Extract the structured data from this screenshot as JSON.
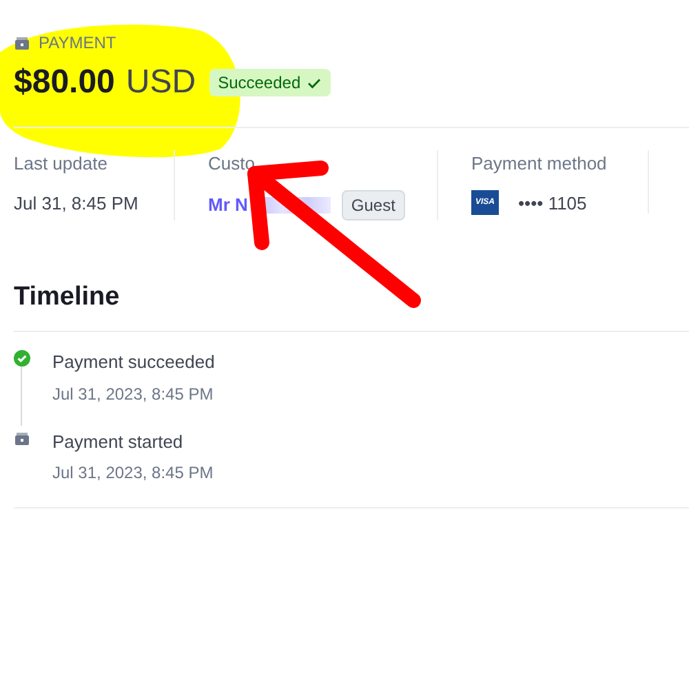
{
  "header": {
    "label": "PAYMENT",
    "amount": "$80.00",
    "currency": "USD",
    "status": {
      "text": "Succeeded",
      "kind": "success"
    }
  },
  "summary": [
    {
      "kind": "text",
      "label": "Last update",
      "value": "Jul 31, 8:45 PM"
    },
    {
      "kind": "customer",
      "label": "Custo",
      "value": "Mr N",
      "badge": "Guest"
    },
    {
      "kind": "card",
      "label": "Payment method",
      "brand": "VISA",
      "value": "•••• 1105"
    }
  ],
  "timeline": {
    "title": "Timeline",
    "events": [
      {
        "kind": "success",
        "title": "Payment succeeded",
        "time": "Jul 31, 2023, 8:45 PM"
      },
      {
        "kind": "started",
        "title": "Payment started",
        "time": "Jul 31, 2023, 8:45 PM"
      }
    ]
  }
}
